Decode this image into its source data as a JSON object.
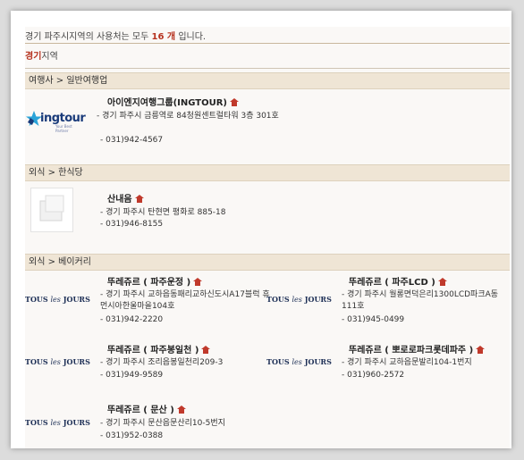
{
  "summary": {
    "prefix": "경기 파주시지역의 사용처는 모두",
    "count": "16 개",
    "suffix": "입니다."
  },
  "region": {
    "strong": "경기",
    "rest": "지역"
  },
  "categories": [
    {
      "label": "여행사 > 일반여행업"
    },
    {
      "label": "외식 > 한식당"
    },
    {
      "label": "외식 > 베이커리"
    }
  ],
  "stores": {
    "ingtour": {
      "name": "아이엔지여행그룹(INGTOUR)",
      "addr": "- 경기 파주시 금릉역로 84청원센트럴타워 3층 301호",
      "tel": "- 031)942-4567",
      "logo": "ingtour",
      "logo_sub": "Your Best Partner"
    },
    "sanaeeum": {
      "name": "산내음",
      "addr": "- 경기 파주시 탄현면 평화로 885-18",
      "tel": "- 031)946-8155"
    },
    "b1": {
      "name": "뚜레쥬르 ( 파주운정 )",
      "addr": "- 경기 파주시 교하읍동패리교하신도시A17블럭 휴먼시아한울마을104호",
      "tel": "- 031)942-2220"
    },
    "b2": {
      "name": "뚜레쥬르 ( 파주LCD )",
      "addr": "- 경기 파주시 월롱면덕은리1300LCD파크A동 111호",
      "tel": "- 031)945-0499"
    },
    "b3": {
      "name": "뚜레쥬르 ( 파주봉일천 )",
      "addr": "- 경기 파주시 조리읍봉일천리209-3",
      "tel": "- 031)949-9589"
    },
    "b4": {
      "name": "뚜레쥬르 ( 뽀로로파크롯데파주 )",
      "addr": "- 경기 파주시 교하읍문발리104-1번지",
      "tel": "- 031)960-2572"
    },
    "b5": {
      "name": "뚜레쥬르 ( 문산 )",
      "addr": "- 경기 파주시 문산읍문산리10-5번지",
      "tel": "- 031)952-0388"
    }
  },
  "tlj_logo": {
    "a": "TOUS",
    "b": "les",
    "c": "JOURS"
  }
}
